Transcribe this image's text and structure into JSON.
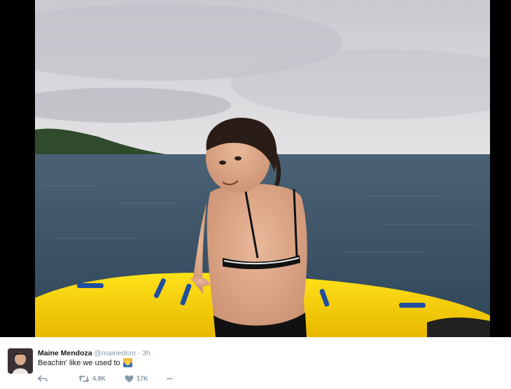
{
  "tweet": {
    "author_name": "Maine Mendoza",
    "author_handle": "@mainedcm",
    "separator": "·",
    "time": "3h",
    "text": "Beachin' like we used to",
    "emoji": "sunrise-over-water",
    "actions": {
      "reply_icon": "reply-icon",
      "retweet_icon": "retweet-icon",
      "retweet_count": "4.8K",
      "like_icon": "heart-icon",
      "like_count": "17K",
      "more_icon": "more-dots-icon",
      "more_label": "•••"
    }
  },
  "colors": {
    "secondary_text": "#8899a6",
    "primary_text": "#14171a",
    "float_yellow": "#f7d20a",
    "sea": "#3d5569"
  }
}
